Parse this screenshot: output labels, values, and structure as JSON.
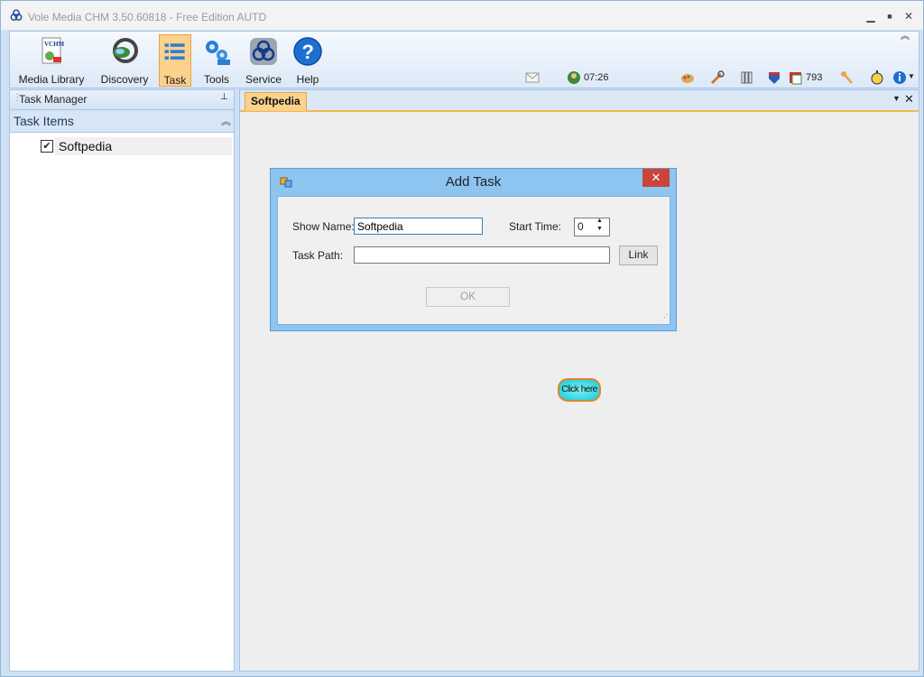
{
  "app": {
    "title": "Vole Media CHM  3.50.60818 - Free Edition AUTD",
    "minimize_label": "▁",
    "maximize_label": "■",
    "close_label": "✕"
  },
  "ribbon": {
    "buttons": [
      {
        "label": "Media Library",
        "icon": "vchm-book-icon"
      },
      {
        "label": "Discovery",
        "icon": "discovery-icon"
      },
      {
        "label": "Task",
        "icon": "task-list-icon"
      },
      {
        "label": "Tools",
        "icon": "gears-icon"
      },
      {
        "label": "Service",
        "icon": "service-icon"
      },
      {
        "label": "Help",
        "icon": "help-icon"
      }
    ],
    "active": "Task",
    "status": {
      "time": "07:26",
      "count": "793"
    }
  },
  "left_panel": {
    "header": "Task Manager",
    "pin": "⊥",
    "section": "Task Items",
    "collapse": "︽",
    "items": [
      {
        "label": "Softpedia",
        "checked": true
      }
    ]
  },
  "right_panel": {
    "tab": "Softpedia",
    "tab_menu": "▼",
    "tab_close": "✕",
    "click_button": "Click here"
  },
  "dialog": {
    "title": "Add Task",
    "close": "✕",
    "show_name_label": "Show Name:",
    "show_name_value": "Softpedia",
    "start_time_label": "Start Time:",
    "start_time_value": "0",
    "task_path_label": "Task Path:",
    "task_path_value": "",
    "link_label": "Link",
    "ok_label": "OK"
  },
  "colors": {
    "accent": "#fbd18c",
    "frame": "#cfe0f3",
    "dialog_border": "#8ec4f0",
    "close_red": "#c9443a"
  }
}
